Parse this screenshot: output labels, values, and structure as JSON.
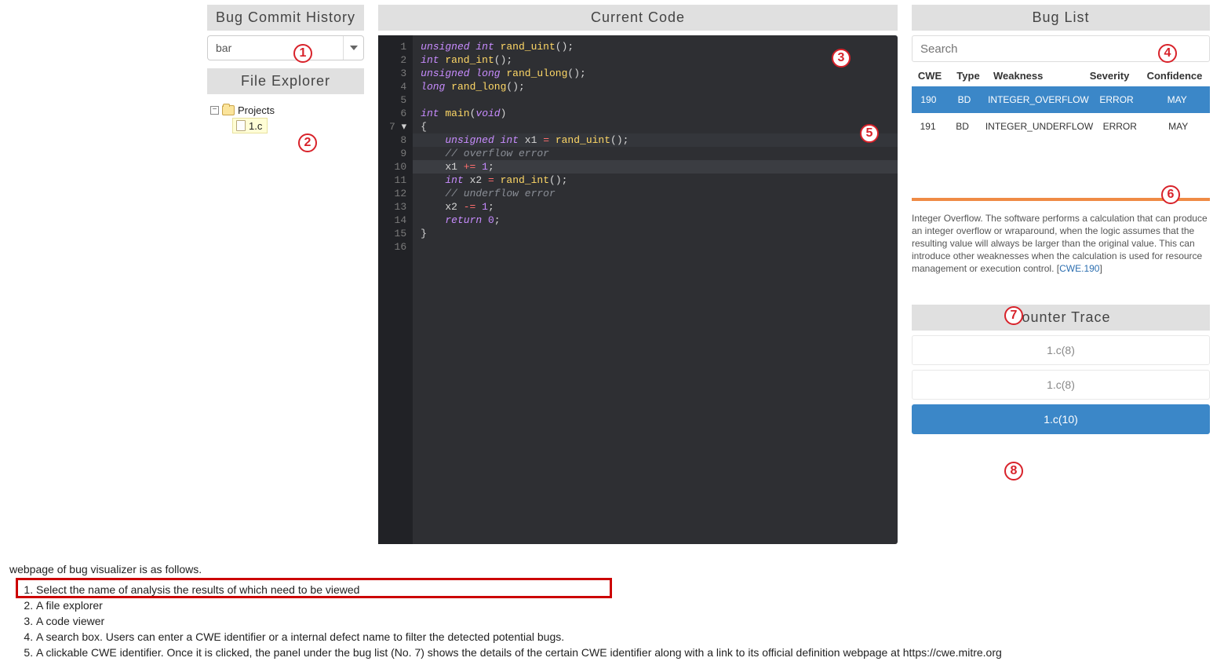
{
  "left": {
    "bug_commit_header": "Bug Commit History",
    "analysis_selected": "bar",
    "file_explorer_header": "File Explorer",
    "tree_root": "Projects",
    "tree_file": "1.c"
  },
  "center": {
    "header": "Current Code",
    "code": {
      "lines": [
        {
          "n": "1",
          "seg": [
            [
              "ty",
              "unsigned int"
            ],
            [
              "",
              " "
            ],
            [
              "fn",
              "rand_uint"
            ],
            [
              "",
              "();"
            ]
          ]
        },
        {
          "n": "2",
          "seg": [
            [
              "ty",
              "int"
            ],
            [
              "",
              " "
            ],
            [
              "fn",
              "rand_int"
            ],
            [
              "",
              "();"
            ]
          ]
        },
        {
          "n": "3",
          "seg": [
            [
              "ty",
              "unsigned long"
            ],
            [
              "",
              " "
            ],
            [
              "fn",
              "rand_ulong"
            ],
            [
              "",
              "();"
            ]
          ]
        },
        {
          "n": "4",
          "seg": [
            [
              "ty",
              "long"
            ],
            [
              "",
              " "
            ],
            [
              "fn",
              "rand_long"
            ],
            [
              "",
              "();"
            ]
          ]
        },
        {
          "n": "5",
          "seg": [
            [
              "",
              ""
            ]
          ]
        },
        {
          "n": "6",
          "seg": [
            [
              "ty",
              "int"
            ],
            [
              "",
              " "
            ],
            [
              "fn",
              "main"
            ],
            [
              "",
              "("
            ],
            [
              "ty",
              "void"
            ],
            [
              "",
              ")"
            ]
          ]
        },
        {
          "n": "7",
          "arrow": true,
          "seg": [
            [
              "",
              "{"
            ]
          ]
        },
        {
          "n": "8",
          "hl2": true,
          "seg": [
            [
              "",
              "    "
            ],
            [
              "ty",
              "unsigned int"
            ],
            [
              "",
              " x1 "
            ],
            [
              "op",
              "="
            ],
            [
              "",
              " "
            ],
            [
              "fn",
              "rand_uint"
            ],
            [
              "",
              "();"
            ]
          ]
        },
        {
          "n": "9",
          "seg": [
            [
              "",
              "    "
            ],
            [
              "cm",
              "// overflow error"
            ]
          ]
        },
        {
          "n": "10",
          "hl": true,
          "seg": [
            [
              "",
              "    x1 "
            ],
            [
              "op",
              "+="
            ],
            [
              "",
              " "
            ],
            [
              "num",
              "1"
            ],
            [
              "",
              ";"
            ]
          ]
        },
        {
          "n": "11",
          "seg": [
            [
              "",
              "    "
            ],
            [
              "ty",
              "int"
            ],
            [
              "",
              " x2 "
            ],
            [
              "op",
              "="
            ],
            [
              "",
              " "
            ],
            [
              "fn",
              "rand_int"
            ],
            [
              "",
              "();"
            ]
          ]
        },
        {
          "n": "12",
          "seg": [
            [
              "",
              "    "
            ],
            [
              "cm",
              "// underflow error"
            ]
          ]
        },
        {
          "n": "13",
          "seg": [
            [
              "",
              "    x2 "
            ],
            [
              "op",
              "-="
            ],
            [
              "",
              " "
            ],
            [
              "num",
              "1"
            ],
            [
              "",
              ";"
            ]
          ]
        },
        {
          "n": "14",
          "seg": [
            [
              "",
              "    "
            ],
            [
              "kw",
              "return"
            ],
            [
              "",
              " "
            ],
            [
              "num",
              "0"
            ],
            [
              "",
              ";"
            ]
          ]
        },
        {
          "n": "15",
          "seg": [
            [
              "",
              "}"
            ]
          ]
        },
        {
          "n": "16",
          "seg": [
            [
              "",
              ""
            ]
          ]
        }
      ]
    }
  },
  "right": {
    "bug_list_header": "Bug List",
    "search_placeholder": "Search",
    "columns": {
      "cwe": "CWE",
      "type": "Type",
      "weak": "Weakness",
      "sev": "Severity",
      "conf": "Confidence"
    },
    "rows": [
      {
        "cwe": "190",
        "type": "BD",
        "weak": "INTEGER_OVERFLOW",
        "sev": "ERROR",
        "conf": "MAY",
        "selected": true
      },
      {
        "cwe": "191",
        "type": "BD",
        "weak": "INTEGER_UNDERFLOW",
        "sev": "ERROR",
        "conf": "MAY",
        "selected": false
      }
    ],
    "description_text": "Integer Overflow. The software performs a calculation that can produce an integer overflow or wraparound, when the logic assumes that the resulting value will always be larger than the original value. This can introduce other weaknesses when the calculation is used for resource management or execution control.",
    "description_link": "CWE.190",
    "counter_trace_header": "Counter Trace",
    "trace": [
      {
        "label": "1.c(8)",
        "selected": false
      },
      {
        "label": "1.c(8)",
        "selected": false
      },
      {
        "label": "1.c(10)",
        "selected": true
      }
    ]
  },
  "bottom": {
    "intro": "webpage of bug visualizer is as follows.",
    "items": [
      "Select the name of analysis the results of which need to be viewed",
      "A file explorer",
      "A code viewer",
      "A search box. Users can enter a CWE identifier or a internal defect name to filter the detected potential bugs.",
      "A clickable CWE identifier. Once it is clicked, the panel under the bug list (No. 7) shows the details of the certain CWE identifier along with a link to its official definition webpage at https://cwe.mitre.org"
    ]
  },
  "annotations": [
    "1",
    "2",
    "3",
    "4",
    "5",
    "6",
    "7",
    "8"
  ]
}
